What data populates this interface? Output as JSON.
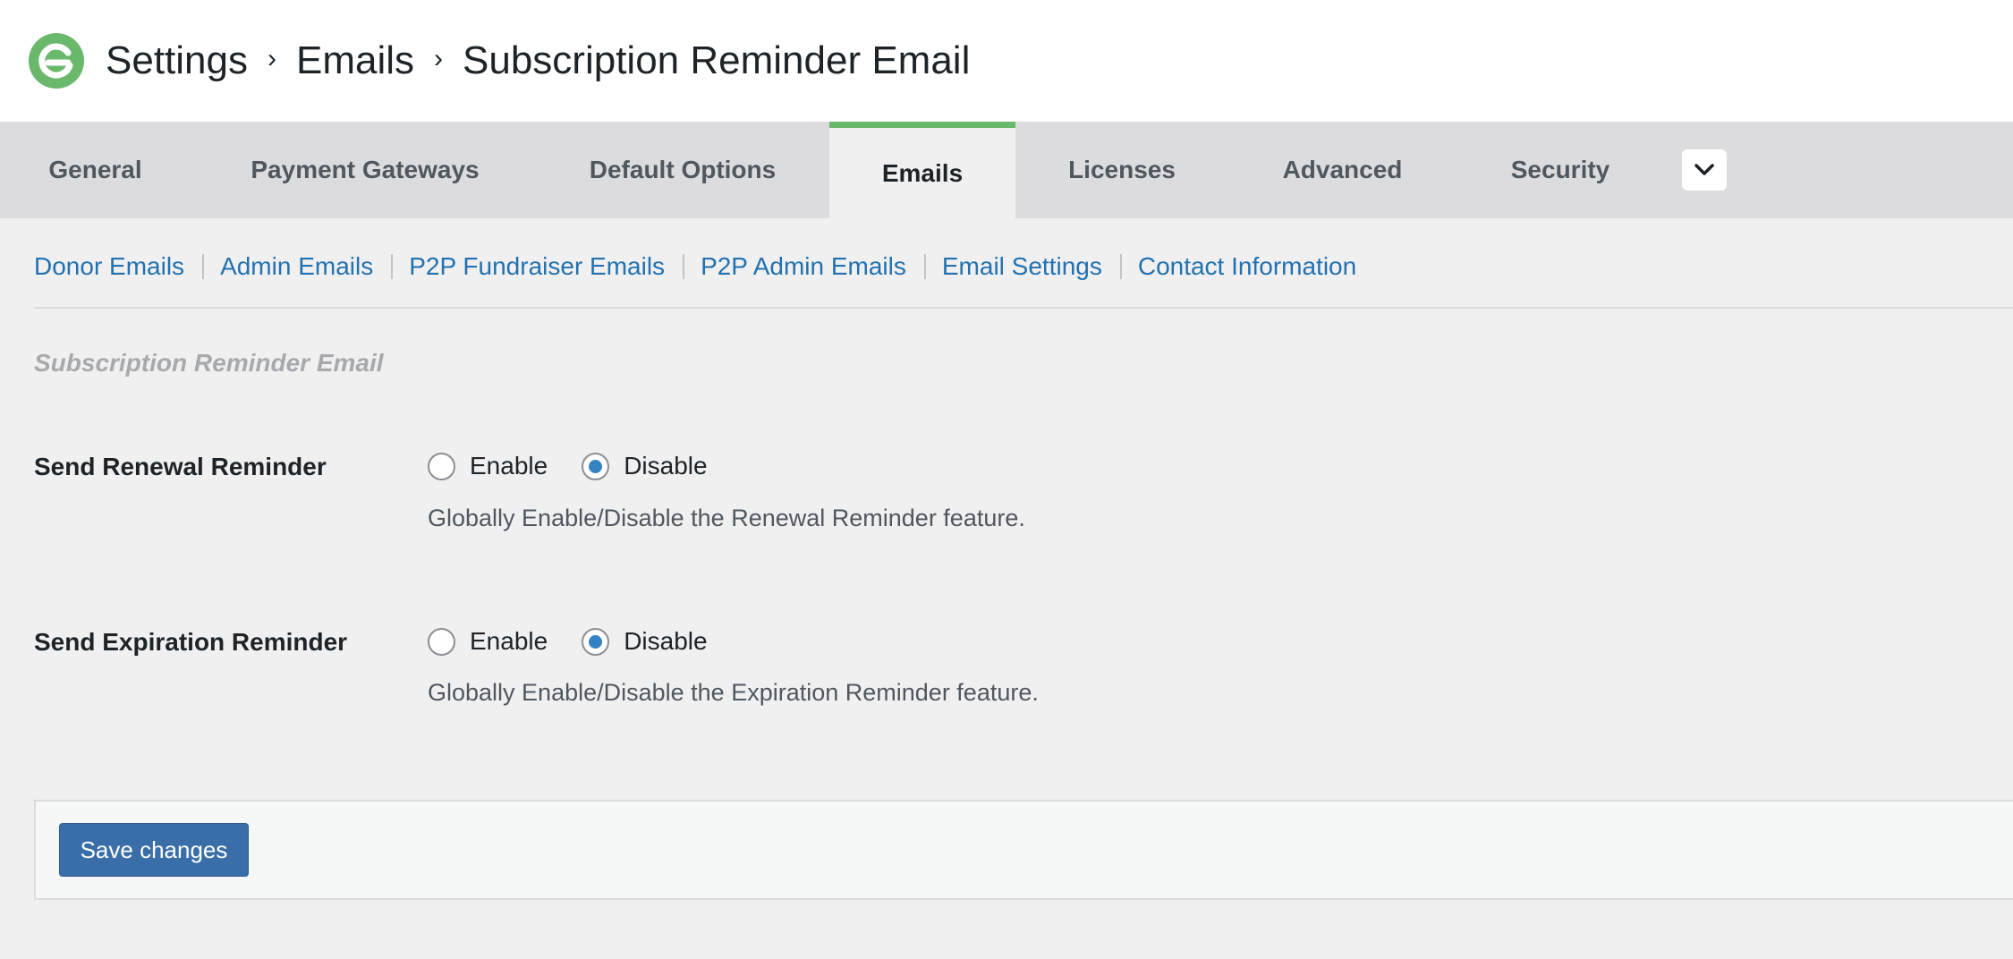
{
  "header": {
    "breadcrumb": [
      "Settings",
      "Emails",
      "Subscription Reminder Email"
    ],
    "separator": "›"
  },
  "tabs": [
    {
      "label": "General",
      "active": false
    },
    {
      "label": "Payment Gateways",
      "active": false
    },
    {
      "label": "Default Options",
      "active": false
    },
    {
      "label": "Emails",
      "active": true
    },
    {
      "label": "Licenses",
      "active": false
    },
    {
      "label": "Advanced",
      "active": false
    },
    {
      "label": "Security",
      "active": false
    }
  ],
  "subnav": [
    "Donor Emails",
    "Admin Emails",
    "P2P Fundraiser Emails",
    "P2P Admin Emails",
    "Email Settings",
    "Contact Information"
  ],
  "section_title": "Subscription Reminder Email",
  "settings": [
    {
      "label": "Send Renewal Reminder",
      "options": [
        "Enable",
        "Disable"
      ],
      "selected": "Disable",
      "description": "Globally Enable/Disable the Renewal Reminder feature."
    },
    {
      "label": "Send Expiration Reminder",
      "options": [
        "Enable",
        "Disable"
      ],
      "selected": "Disable",
      "description": "Globally Enable/Disable the Expiration Reminder feature."
    }
  ],
  "save_label": "Save changes",
  "colors": {
    "accent_tab": "#69b86b",
    "link": "#2271b1",
    "button": "#3a6ea8",
    "radio_checked": "#3582c4"
  },
  "icons": {
    "logo": "givewp-logo-icon",
    "more": "chevron-down-icon"
  }
}
